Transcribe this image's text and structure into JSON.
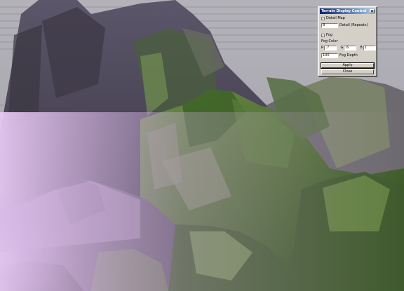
{
  "window": {
    "title": "Terrain Display Control",
    "close_glyph": "x"
  },
  "detail_map": {
    "label": "Detail Map",
    "checked": true,
    "repeats_value": "8",
    "repeats_label": "Detail (Repeats)"
  },
  "fog": {
    "label": "Fog",
    "checked": true,
    "color_label": "Fog Color",
    "r_label": "R",
    "r_value": ".7",
    "g_label": "G",
    "g_value": ".6",
    "b_label": "B",
    "b_value": "1",
    "depth_value": "100",
    "depth_label": "Fog Depth"
  },
  "buttons": {
    "apply": "Apply",
    "close": "Close"
  },
  "colors": {
    "fog": "#d8b8e8",
    "grass": "#4f7a2a",
    "rock": "#4c4658",
    "sky": "#a9a7ae",
    "titlebar": "#0a246a"
  },
  "icons": [
    "checkmark-icon",
    "close-icon"
  ]
}
